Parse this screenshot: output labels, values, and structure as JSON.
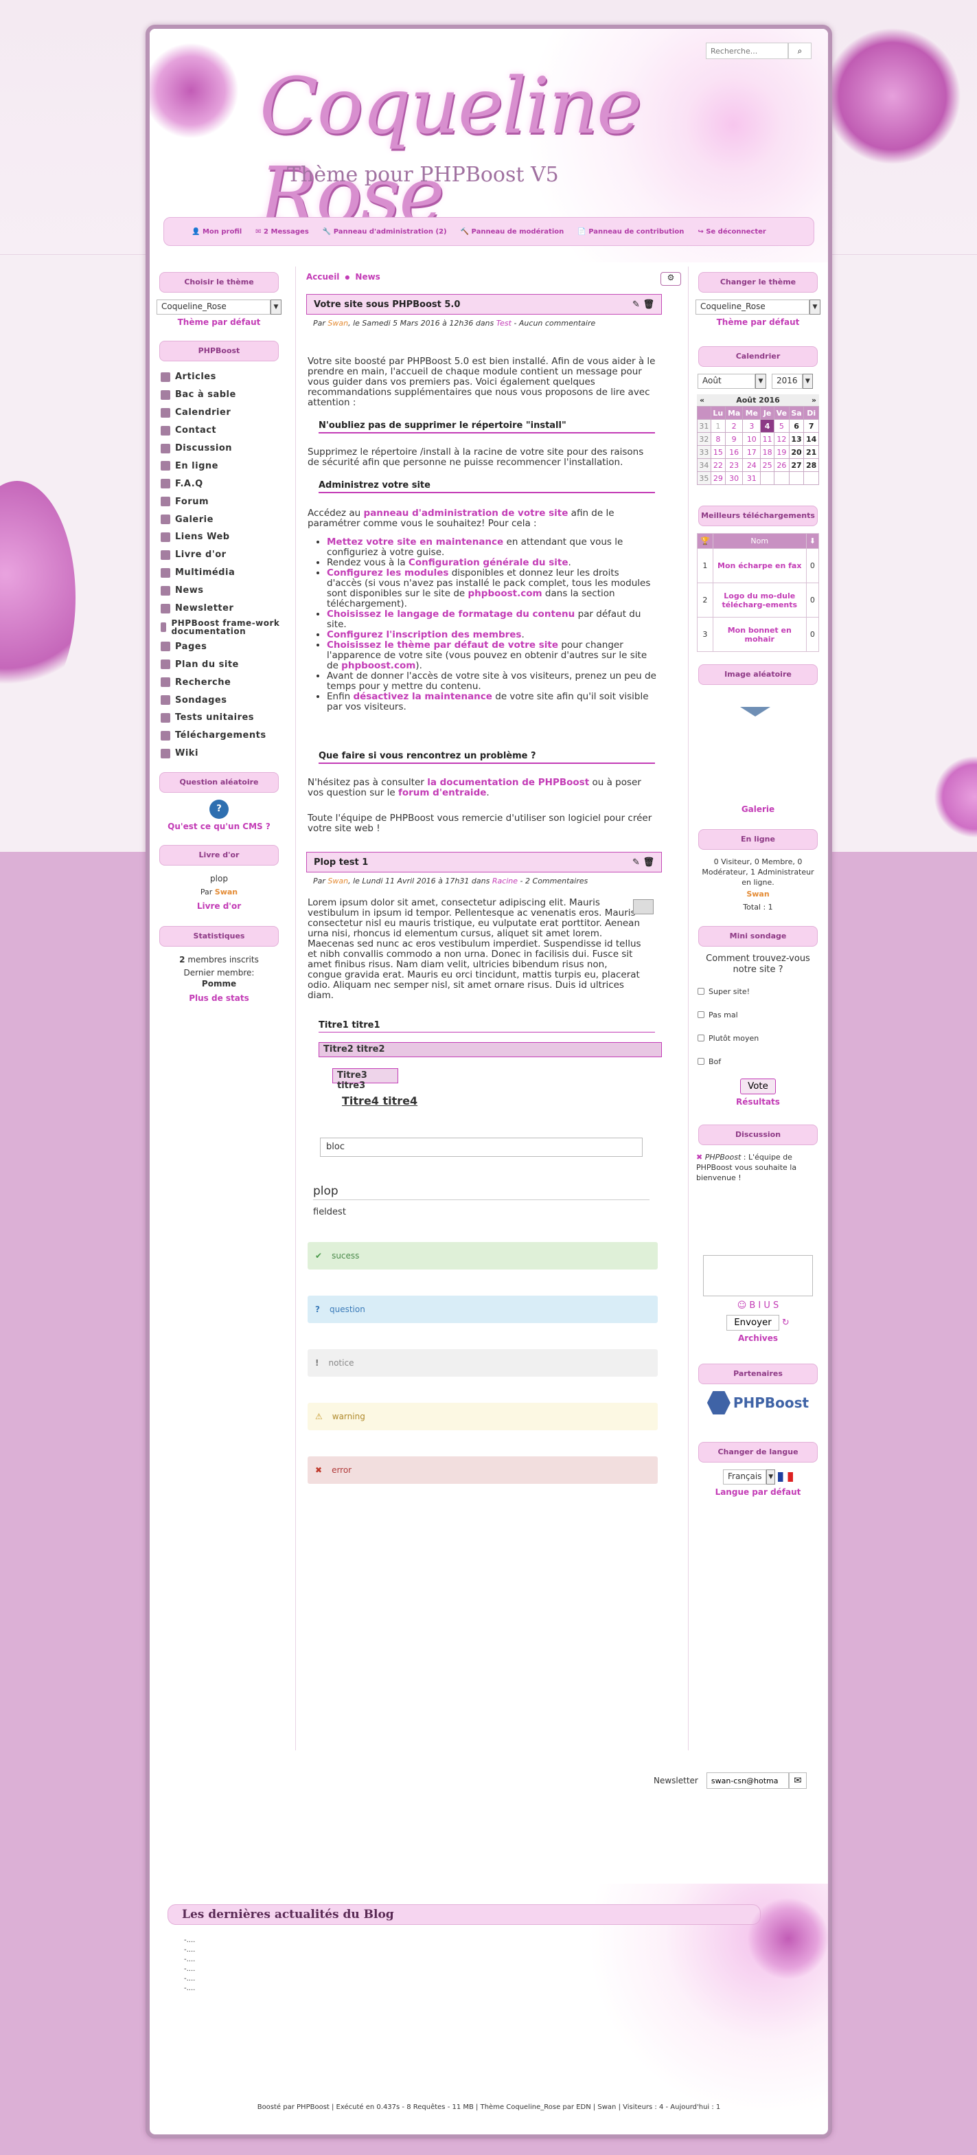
{
  "search": {
    "placeholder": "Recherche..."
  },
  "site": {
    "title": "Coqueline Rose",
    "subtitle": "Thème pour PHPBoost V5"
  },
  "nav": [
    "Mon profil",
    "2 Messages",
    "Panneau d'administration (2)",
    "Panneau de modération",
    "Panneau de contribution",
    "Se déconnecter"
  ],
  "left": {
    "theme_title": "Choisir le thème",
    "theme_value": "Coqueline_Rose",
    "theme_default": "Thème par défaut",
    "menu_title": "PHPBoost",
    "menu": [
      "Articles",
      "Bac à sable",
      "Calendrier",
      "Contact",
      "Discussion",
      "En ligne",
      "F.A.Q",
      "Forum",
      "Galerie",
      "Liens Web",
      "Livre d'or",
      "Multimédia",
      "News",
      "Newsletter",
      "PHPBoost frame-work documentation",
      "Pages",
      "Plan du site",
      "Recherche",
      "Sondages",
      "Tests unitaires",
      "Téléchargements",
      "Wiki"
    ],
    "question_title": "Question aléatoire",
    "question": "Qu'est ce qu'un CMS ?",
    "guest_title": "Livre d'or",
    "guest_msg": "plop",
    "guest_by": "Par",
    "guest_author": "Swan",
    "guest_link": "Livre d'or",
    "stats_title": "Statistiques",
    "stats_members": "2",
    "stats_members_label": "membres inscrits",
    "stats_last": "Dernier membre:",
    "stats_last_name": "Pomme",
    "stats_more": "Plus de stats"
  },
  "main": {
    "crumbs": [
      "Accueil",
      "News"
    ],
    "art1": {
      "title": "Votre site sous PHPBoost 5.0",
      "meta_pre": "Par",
      "author": "Swan",
      "date": ", le Samedi 5 Mars 2016 à 12h36 dans",
      "cat": "Test",
      "comments": "- Aucun commentaire",
      "p1": "Votre site boosté par PHPBoost 5.0 est bien installé. Afin de vous aider à le prendre en main, l'accueil de chaque module contient un message pour vous guider dans vos premiers pas. Voici également quelques recommandations supplémentaires que nous vous proposons de lire avec attention :",
      "h1": "N'oubliez pas de supprimer le répertoire \"install\"",
      "p2": "Supprimez le répertoire /install à la racine de votre site pour des raisons de sécurité afin que personne ne puisse recommencer l'installation.",
      "h2": "Administrez votre site",
      "p3a": "Accédez au",
      "p3l": "panneau d'administration de votre site",
      "p3b": "afin de le paramétrer comme vous le souhaitez! Pour cela :",
      "li": [
        {
          "a": "Mettez votre site en maintenance",
          "b": " en attendant que vous le configuriez à votre guise."
        },
        {
          "a": "",
          "b": "Rendez vous à la ",
          "c": "Configuration générale du site",
          "d": "."
        },
        {
          "a": "Configurez les modules",
          "b": " disponibles et donnez leur les droits d'accès (si vous n'avez pas installé le pack complet, tous les modules sont disponibles sur le site de ",
          "c": "phpboost.com",
          "d": " dans la section téléchargement)."
        },
        {
          "a": "Choisissez le langage de formatage du contenu",
          "b": " par défaut du site."
        },
        {
          "a": "Configurez l'inscription des membres",
          "b": "."
        },
        {
          "a": "Choisissez le thème par défaut de votre site",
          "b": " pour changer l'apparence de votre site (vous pouvez en obtenir d'autres sur le site de ",
          "c": "phpboost.com",
          "d": ")."
        },
        {
          "a": "",
          "b": "Avant de donner l'accès de votre site à vos visiteurs, prenez un peu de temps pour y mettre du contenu."
        },
        {
          "a": "",
          "b": "Enfin ",
          "c": "désactivez la maintenance",
          "d": " de votre site afin qu'il soit visible par vos visiteurs."
        }
      ],
      "h3": "Que faire si vous rencontrez un problème ?",
      "p4a": "N'hésitez pas à consulter ",
      "p4l": "la documentation de PHPBoost",
      "p4b": " ou à poser vos question sur le ",
      "p4l2": "forum d'entraide",
      "p4c": ".",
      "p5": "Toute l'équipe de PHPBoost vous remercie d'utiliser son logiciel pour créer votre site web !"
    },
    "art2": {
      "title": "Plop test 1",
      "meta_pre": "Par",
      "author": "Swan",
      "date": ", le Lundi 11 Avril 2016 à 17h31 dans",
      "cat": "Racine",
      "comments": "- 2 Commentaires",
      "p1": "Lorem ipsum dolor sit amet, consectetur adipiscing elit. Mauris vestibulum in ipsum id tempor. Pellentesque ac venenatis eros. Mauris consectetur nisl eu mauris tristique, eu vulputate erat porttitor. Aenean urna nisi, rhoncus id elementum cursus, aliquet sit amet lorem. Maecenas sed nunc ac eros vestibulum imperdiet. Suspendisse id tellus et nibh convallis commodo a non urna. Donec in facilisis dui. Fusce sit amet finibus risus. Nam diam velit, ultricies bibendum risus non, congue gravida erat. Mauris eu orci tincidunt, mattis turpis eu, placerat odio. Aliquam nec semper nisl, sit amet ornare risus. Duis id ultrices diam.",
      "t1": "Titre1 titre1",
      "t2": "Titre2 titre2",
      "t3": "Titre3 titre3",
      "t4": "Titre4 titre4",
      "bloc": "bloc",
      "fs_legend": "plop",
      "fs_text": "fieldest",
      "msgs": [
        "sucess",
        "question",
        "notice",
        "warning",
        "error"
      ]
    }
  },
  "right": {
    "theme_title": "Changer le thème",
    "theme_value": "Coqueline_Rose",
    "theme_default": "Thème par défaut",
    "cal_title": "Calendrier",
    "cal_month": "Août",
    "cal_year": "2016",
    "cal_label": "Août 2016",
    "cal_days": [
      "Lu",
      "Ma",
      "Me",
      "Je",
      "Ve",
      "Sa",
      "Di"
    ],
    "cal_rows": [
      [
        "31",
        "1",
        "2",
        "3",
        "4",
        "5",
        "6",
        "7"
      ],
      [
        "32",
        "8",
        "9",
        "10",
        "11",
        "12",
        "13",
        "14"
      ],
      [
        "33",
        "15",
        "16",
        "17",
        "18",
        "19",
        "20",
        "21"
      ],
      [
        "34",
        "22",
        "23",
        "24",
        "25",
        "26",
        "27",
        "28"
      ],
      [
        "35",
        "29",
        "30",
        "31",
        "",
        "",
        "",
        ""
      ]
    ],
    "dl_title": "Meilleurs téléchargements",
    "dl_head": "Nom",
    "dl": [
      [
        "1",
        "Mon écharpe en fax",
        "0"
      ],
      [
        "2",
        "Logo du mo-dule télécharg-ements",
        "0"
      ],
      [
        "3",
        "Mon bonnet en mohair",
        "0"
      ]
    ],
    "img_title": "Image aléatoire",
    "img_link": "Galerie",
    "online_title": "En ligne",
    "online_text": "0 Visiteur, 0 Membre, 0 Modérateur, 1 Administrateur en ligne.",
    "online_user": "Swan",
    "online_total": "Total : 1",
    "poll_title": "Mini sondage",
    "poll_q": "Comment trouvez-vous notre site ?",
    "poll_opts": [
      "Super site!",
      "Pas mal",
      "Plutôt moyen",
      "Bof"
    ],
    "poll_vote": "Vote",
    "poll_results": "Résultats",
    "disc_title": "Discussion",
    "disc_author": "PHPBoost",
    "disc_msg": " : L'équipe de PHPBoost vous souhaite la bienvenue !",
    "disc_send": "Envoyer",
    "disc_archives": "Archives",
    "disc_tools": "☺ B I U S",
    "part_title": "Partenaires",
    "part_name": "PHPBoost",
    "lang_title": "Changer de langue",
    "lang_value": "Français",
    "lang_default": "Langue par défaut"
  },
  "newsletter": {
    "label": "Newsletter",
    "value": "swan-csn@hotma"
  },
  "blog": {
    "title": "Les dernières actualités du Blog",
    "items": [
      "-....",
      "-....",
      "-....",
      "-....",
      "-....",
      "-...."
    ]
  },
  "footer": "Boosté par PHPBoost | Exécuté en 0.437s - 8 Requêtes - 11 MB | Thème Coqueline_Rose par EDN | Swan | Visiteurs : 4 - Aujourd'hui : 1"
}
